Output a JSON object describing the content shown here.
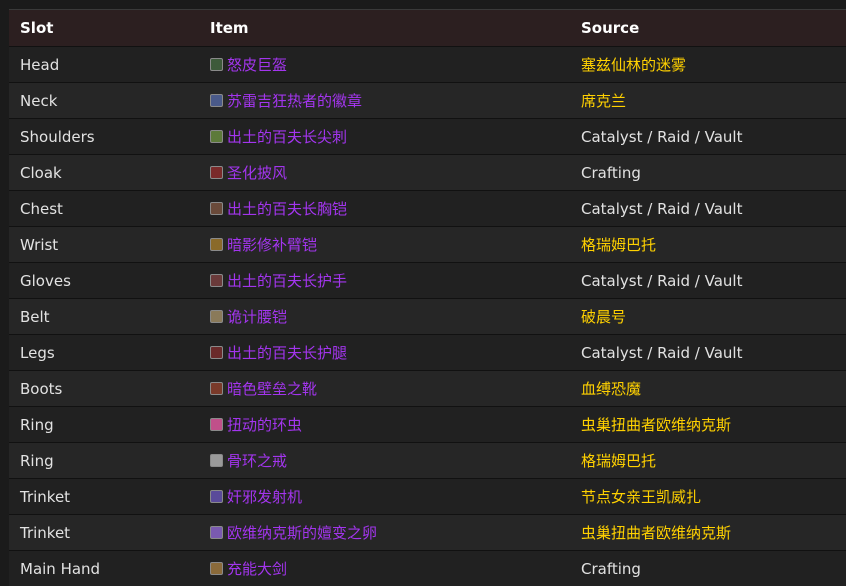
{
  "headers": {
    "slot": "Slot",
    "item": "Item",
    "source": "Source"
  },
  "rows": [
    {
      "slot": "Head",
      "item": "怒皮巨盔",
      "source": "塞兹仙林的迷雾",
      "source_type": "npc",
      "icon": "helm-icon",
      "icon_color": "#3d5a3a"
    },
    {
      "slot": "Neck",
      "item": "苏雷吉狂热者的徽章",
      "source": "席克兰",
      "source_type": "npc",
      "icon": "amulet-icon",
      "icon_color": "#4a5a8a"
    },
    {
      "slot": "Shoulders",
      "item": "出土的百夫长尖刺",
      "source": "Catalyst / Raid / Vault",
      "source_type": "generic",
      "icon": "shoulder-icon",
      "icon_color": "#5d7a3a"
    },
    {
      "slot": "Cloak",
      "item": "圣化披风",
      "source": "Crafting",
      "source_type": "generic",
      "icon": "cloak-icon",
      "icon_color": "#7a2a2a"
    },
    {
      "slot": "Chest",
      "item": "出土的百夫长胸铠",
      "source": "Catalyst / Raid / Vault",
      "source_type": "generic",
      "icon": "chest-icon",
      "icon_color": "#6a4a3a"
    },
    {
      "slot": "Wrist",
      "item": "暗影修补臂铠",
      "source": "格瑞姆巴托",
      "source_type": "npc",
      "icon": "bracer-icon",
      "icon_color": "#8a6a2a"
    },
    {
      "slot": "Gloves",
      "item": "出土的百夫长护手",
      "source": "Catalyst / Raid / Vault",
      "source_type": "generic",
      "icon": "gloves-icon",
      "icon_color": "#6a3a3a"
    },
    {
      "slot": "Belt",
      "item": "诡计腰铠",
      "source": "破晨号",
      "source_type": "npc",
      "icon": "belt-icon",
      "icon_color": "#8a7a5a"
    },
    {
      "slot": "Legs",
      "item": "出土的百夫长护腿",
      "source": "Catalyst / Raid / Vault",
      "source_type": "generic",
      "icon": "legs-icon",
      "icon_color": "#6a2a2a"
    },
    {
      "slot": "Boots",
      "item": "暗色壁垒之靴",
      "source": "血缚恐魔",
      "source_type": "npc",
      "icon": "boots-icon",
      "icon_color": "#7a3a2a"
    },
    {
      "slot": "Ring",
      "item": "扭动的环虫",
      "source": "虫巢扭曲者欧维纳克斯",
      "source_type": "npc",
      "icon": "ring-icon",
      "icon_color": "#c0508a"
    },
    {
      "slot": "Ring",
      "item": "骨环之戒",
      "source": "格瑞姆巴托",
      "source_type": "npc",
      "icon": "ring-icon",
      "icon_color": "#9a9a9a"
    },
    {
      "slot": "Trinket",
      "item": "奸邪发射机",
      "source": "节点女亲王凯威扎",
      "source_type": "npc",
      "icon": "trinket-icon",
      "icon_color": "#5a4a9a"
    },
    {
      "slot": "Trinket",
      "item": "欧维纳克斯的嬗变之卵",
      "source": "虫巢扭曲者欧维纳克斯",
      "source_type": "npc",
      "icon": "trinket-icon",
      "icon_color": "#7a5ab0"
    },
    {
      "slot": "Main Hand",
      "item": "充能大剑",
      "source": "Crafting",
      "source_type": "generic",
      "icon": "sword-icon",
      "icon_color": "#8a6a3a"
    }
  ]
}
